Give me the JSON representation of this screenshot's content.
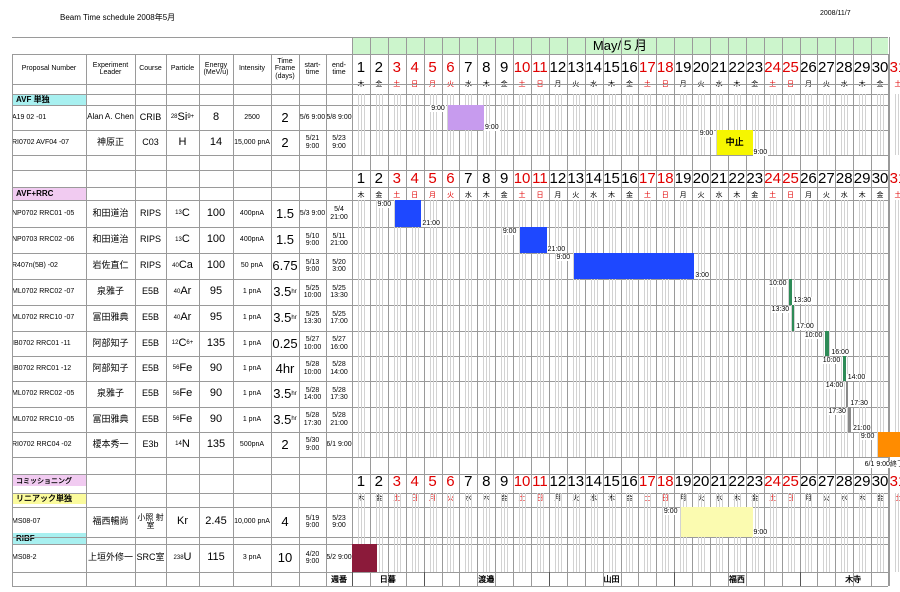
{
  "doc_title": "Beam Time schedule  2008年5月",
  "doc_date": "2008/11/7",
  "month_label": "May/５月",
  "columns": {
    "proposal": "Proposal Number",
    "leader": "Experiment Leader",
    "course": "Course",
    "particle": "Particle",
    "energy": "Energy (MeV/u)",
    "intensity": "Intensity",
    "timeframe": "Time Frame (days)",
    "start": "start-time",
    "end": "end-time"
  },
  "weekdays": [
    "木",
    "金",
    "土",
    "日",
    "月",
    "火",
    "水",
    "木",
    "金",
    "土",
    "日",
    "月",
    "火",
    "水",
    "木",
    "金",
    "土",
    "日",
    "月",
    "火",
    "水",
    "木",
    "金",
    "土",
    "日",
    "月",
    "火",
    "水",
    "木",
    "金",
    "土"
  ],
  "sections": {
    "avf": "AVF 単独",
    "avfrrc": "AVF+RRC",
    "comm": "コミッショニング",
    "linac": "リニアック単独",
    "ribf": "RIBF"
  },
  "rows": [
    {
      "id": "A19  02  -01",
      "leader": "Alan A. Chen",
      "course": "CRIB",
      "pmass": "28",
      "pel": "Si",
      "pchg": "9+",
      "energy": "8",
      "intensity": "2500",
      "tf": "2",
      "tfu": "",
      "start": "5/6 9:00",
      "end": "5/8 9:00"
    },
    {
      "id": "RI0702 AVF04 -07",
      "leader": "神原正",
      "course": "C03",
      "pmass": "",
      "pel": "H",
      "pchg": "",
      "energy": "14",
      "intensity": "15,000 pnA",
      "tf": "2",
      "tfu": "",
      "start": "5/21 9:00",
      "end": "5/23 9:00"
    },
    {
      "id": "NP0702 RRC01 -05",
      "leader": "和田道治",
      "course": "RIPS",
      "pmass": "13",
      "pel": "C",
      "pchg": "",
      "energy": "100",
      "intensity": "400pnA",
      "tf": "1.5",
      "tfu": "",
      "start": "5/3 9:00",
      "end": "5/4 21:00"
    },
    {
      "id": "NP0703 RRC02 -06",
      "leader": "和田道治",
      "course": "RIPS",
      "pmass": "13",
      "pel": "C",
      "pchg": "",
      "energy": "100",
      "intensity": "400pnA",
      "tf": "1.5",
      "tfu": "",
      "start": "5/10 9:00",
      "end": "5/11 21:00"
    },
    {
      "id": "R407n(5B)     -02",
      "leader": "岩佐直仁",
      "course": "RIPS",
      "pmass": "40",
      "pel": "Ca",
      "pchg": "",
      "energy": "100",
      "intensity": "50 pnA",
      "tf": "6.75",
      "tfu": "",
      "start": "5/13 9:00",
      "end": "5/20 3:00"
    },
    {
      "id": "ML0702 RRC02 -07",
      "leader": "泉雅子",
      "course": "E5B",
      "pmass": "40",
      "pel": "Ar",
      "pchg": "",
      "energy": "95",
      "intensity": "1 pnA",
      "tf": "3.5",
      "tfu": "hr",
      "start": "5/25 10:00",
      "end": "5/25 13:30"
    },
    {
      "id": "ML0702 RRC10 -07",
      "leader": "冨田雅典",
      "course": "E5B",
      "pmass": "40",
      "pel": "Ar",
      "pchg": "",
      "energy": "95",
      "intensity": "1 pnA",
      "tf": "3.5",
      "tfu": "hr",
      "start": "5/25 13:30",
      "end": "5/25 17:00"
    },
    {
      "id": "IB0702 RRC01 -11",
      "leader": "阿部知子",
      "course": "E5B",
      "pmass": "12",
      "pel": "C",
      "pchg": "6+",
      "energy": "135",
      "intensity": "1 pnA",
      "tf": "0.25",
      "tfu": "",
      "start": "5/27 10:00",
      "end": "5/27 16:00"
    },
    {
      "id": "IB0702 RRC01 -12",
      "leader": "阿部知子",
      "course": "E5B",
      "pmass": "56",
      "pel": "Fe",
      "pchg": "",
      "energy": "90",
      "intensity": "1 pnA",
      "tf": "4hr",
      "tfu": "",
      "start": "5/28 10:00",
      "end": "5/28 14:00"
    },
    {
      "id": "ML0702 RRC02 -05",
      "leader": "泉雅子",
      "course": "E5B",
      "pmass": "56",
      "pel": "Fe",
      "pchg": "",
      "energy": "90",
      "intensity": "1 pnA",
      "tf": "3.5",
      "tfu": "hr",
      "start": "5/28 14:00",
      "end": "5/28 17:30"
    },
    {
      "id": "ML0702 RRC10 -05",
      "leader": "冨田雅典",
      "course": "E5B",
      "pmass": "56",
      "pel": "Fe",
      "pchg": "",
      "energy": "90",
      "intensity": "1 pnA",
      "tf": "3.5",
      "tfu": "hr",
      "start": "5/28 17:30",
      "end": "5/28 21:00"
    },
    {
      "id": "RI0702 RRC04 -02",
      "leader": "榎本秀一",
      "course": "E3b",
      "pmass": "14",
      "pel": "N",
      "pchg": "",
      "energy": "135",
      "intensity": "500pnA",
      "tf": "2",
      "tfu": "",
      "start": "5/30 9:00",
      "end": "6/1 9:00"
    },
    {
      "id": "MS08-07",
      "leader": "福西暢尚",
      "course": "小照 射室",
      "pmass": "",
      "pel": "Kr",
      "pchg": "",
      "energy": "2.45",
      "intensity": "10,000 pnA",
      "tf": "4",
      "tfu": "",
      "start": "5/19 9:00",
      "end": "5/23 9:00"
    },
    {
      "id": "MS08-2",
      "leader": "上垣外修一",
      "course": "SRC室",
      "pmass": "238",
      "pel": "U",
      "pchg": "",
      "energy": "115",
      "intensity": "3 pnA",
      "tf": "10",
      "tfu": "",
      "start": "4/20 9:00",
      "end": "5/2 9:00"
    }
  ],
  "gantt": {
    "cancel_label": "中止",
    "row0_t1": "9:00",
    "row0_t2": "9:00",
    "row1_t1": "9:00",
    "row1_t2": "9:00",
    "row2_t1": "9:00",
    "row2_t2": "21:00",
    "row3_t1": "9:00",
    "row3_t2": "21:00",
    "row4_t1": "9:00",
    "row4_t2": "3:00",
    "row5_t1": "10:00",
    "row5_t2": "13:30",
    "row6_t1": "13:30",
    "row6_t2": "17:00",
    "row7_t1": "10:00",
    "row7_t2": "16:00",
    "row8_t1": "10:00",
    "row8_t2": "14:00",
    "row9_t1": "14:00",
    "row9_t2": "17:30",
    "row10_t1": "17:30",
    "row10_t2": "21:00",
    "row11_t1": "9:00",
    "row11_end_note": "6/1 9:00終了",
    "row12_t1": "9:00",
    "row12_t2": "9:00"
  },
  "footer": {
    "label": "週番",
    "weeks": [
      "日暮",
      "渡邉",
      "山田",
      "福西",
      "木寺"
    ]
  },
  "colors": {
    "purple": "#c79bee",
    "yellow": "#f6f600",
    "blue": "#1e48ff",
    "green": "#2e8b57",
    "gray": "#8a8a8a",
    "orange": "#ff8c00",
    "lightyellow": "#fbfbb0",
    "maroon": "#8b1a3a",
    "green_header": "#ccf5cc",
    "cyan_section": "#a8f0f0",
    "pink_section": "#f1cbf1",
    "lyellow_section": "#fbfb9c"
  }
}
